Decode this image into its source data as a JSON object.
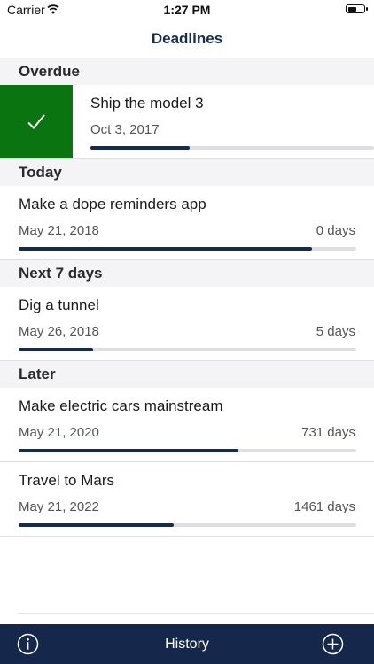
{
  "status_bar": {
    "carrier": "Carrier",
    "time": "1:27 PM"
  },
  "nav": {
    "title": "Deadlines"
  },
  "sections": [
    {
      "header": "Overdue"
    },
    {
      "header": "Today"
    },
    {
      "header": "Next 7 days"
    },
    {
      "header": "Later"
    }
  ],
  "items": [
    {
      "title": "Ship the model 3",
      "date": "Oct 3, 2017",
      "remaining": "",
      "progress": 0.35
    },
    {
      "title": "Make a dope reminders app",
      "date": "May 21, 2018",
      "remaining": "0 days",
      "progress": 0.87
    },
    {
      "title": "Dig a tunnel",
      "date": "May 26, 2018",
      "remaining": "5 days",
      "progress": 0.22
    },
    {
      "title": "Make electric cars mainstream",
      "date": "May 21, 2020",
      "remaining": "731 days",
      "progress": 0.65
    },
    {
      "title": "Travel to Mars",
      "date": "May 21, 2022",
      "remaining": "1461 days",
      "progress": 0.46
    }
  ],
  "toolbar": {
    "history_label": "History"
  },
  "colors": {
    "navy": "#152b52",
    "done_green": "#0a7410",
    "track": "#dedee4"
  },
  "icons": {
    "done": "checkmark-icon",
    "info": "info-icon",
    "add": "plus-circle-icon"
  }
}
